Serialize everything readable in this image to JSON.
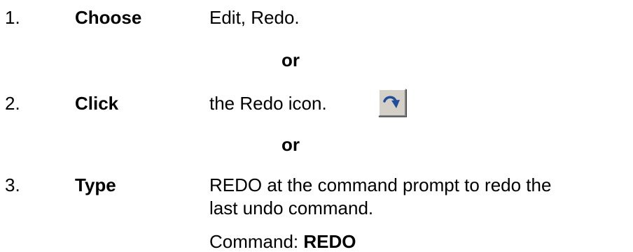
{
  "steps": [
    {
      "number": "1.",
      "verb": "Choose",
      "text": "Edit, Redo."
    },
    {
      "number": "2.",
      "verb": "Click",
      "text": "the Redo icon."
    },
    {
      "number": "3.",
      "verb": "Type",
      "text_line1": "REDO at the command prompt to redo the",
      "text_line2": "last undo command."
    }
  ],
  "separator": "or",
  "command": {
    "prefix": "Command: ",
    "value": "REDO"
  },
  "icon": {
    "name": "redo-icon",
    "color": "#1f4e9c",
    "face": "#d4d0c8"
  }
}
